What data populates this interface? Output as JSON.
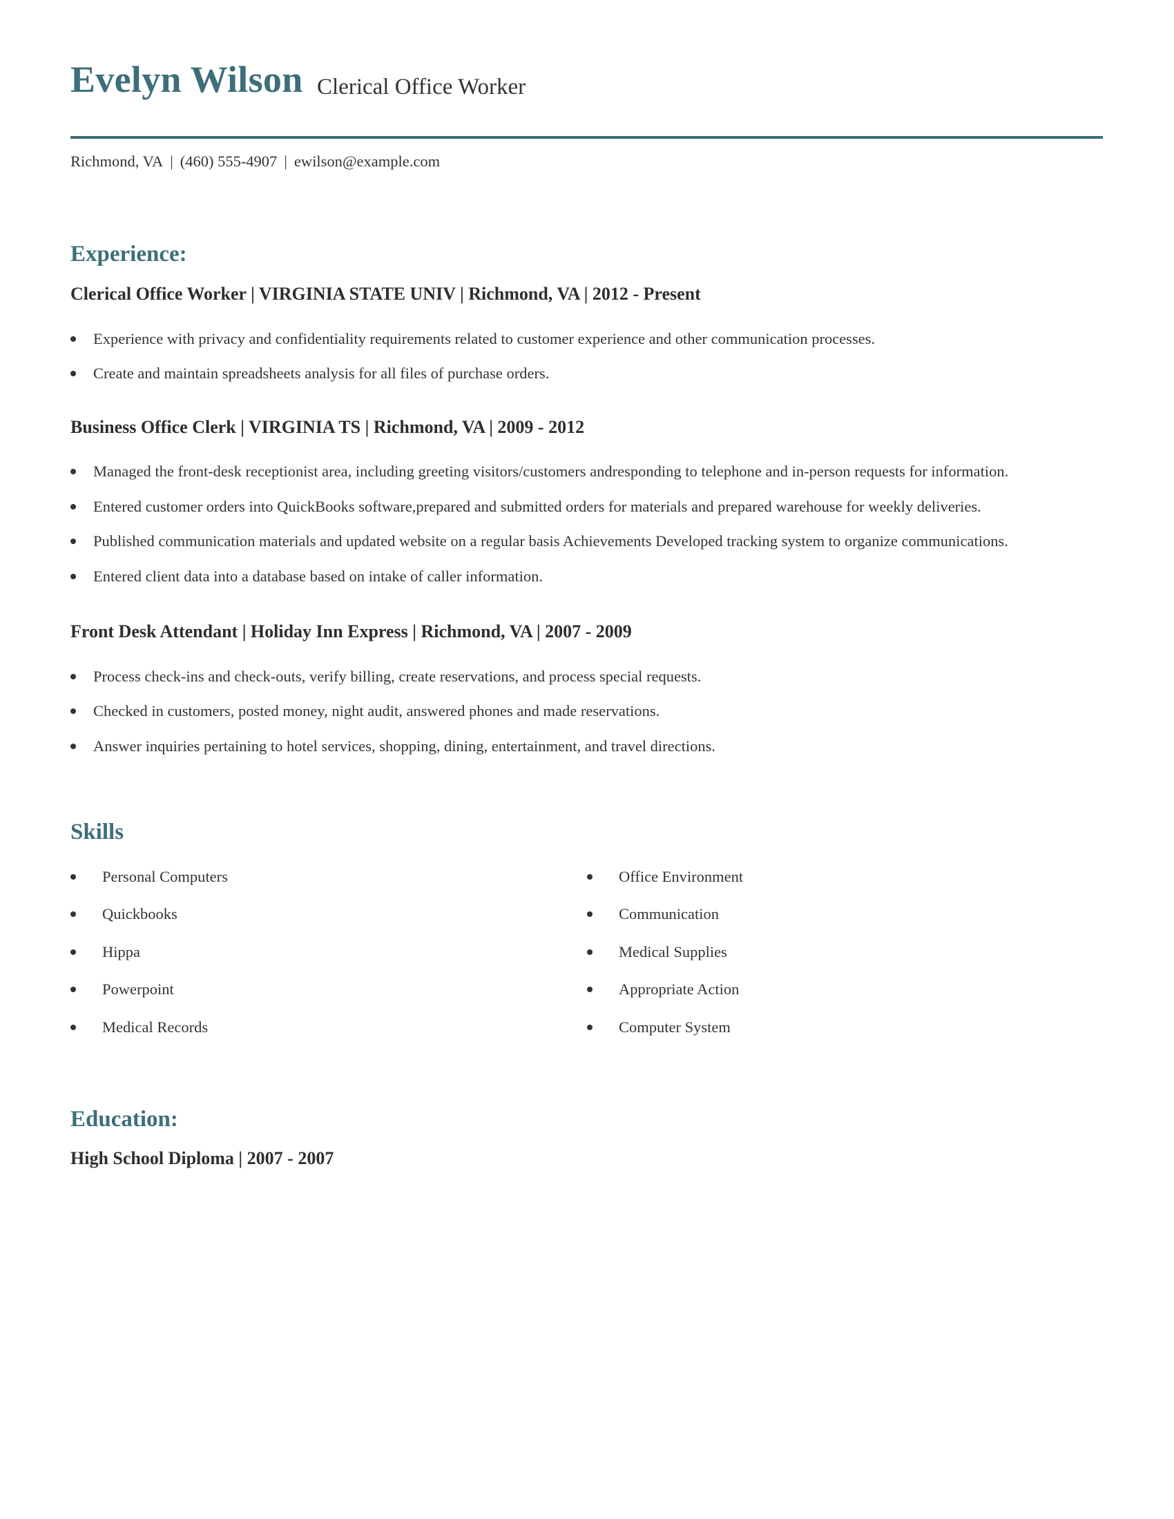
{
  "header": {
    "name": "Evelyn Wilson",
    "title": "Clerical Office Worker",
    "accent_color": "#3d6e7a"
  },
  "contact": {
    "location": "Richmond, VA",
    "separator": "|",
    "phone": "(460) 555-4907",
    "email": "ewilson@example.com"
  },
  "experience": {
    "heading": "Experience:",
    "jobs": [
      {
        "title_line": "Clerical Office Worker | VIRGINIA STATE UNIV | Richmond, VA |  2012 - Present",
        "bullets": [
          "Experience with privacy and confidentiality requirements related to customer experience and other communication processes.",
          "Create and maintain spreadsheets analysis for all files of purchase orders."
        ]
      },
      {
        "title_line": "Business Office Clerk | VIRGINIA TS | Richmond, VA |  2009 - 2012",
        "bullets": [
          "Managed the front-desk receptionist area, including greeting visitors/customers andresponding to telephone and in-person requests for information.",
          "Entered customer orders into QuickBooks software,prepared and submitted orders for materials and prepared warehouse for weekly deliveries.",
          "Published communication materials and updated website on a regular basis Achievements Developed tracking system to organize communications.",
          "Entered client data into a database based on intake of caller information."
        ]
      },
      {
        "title_line": "Front Desk Attendant | Holiday Inn Express | Richmond, VA |  2007 - 2009",
        "bullets": [
          "Process check-ins and check-outs, verify billing, create reservations, and process special requests.",
          "Checked in customers, posted money, night audit, answered phones and made reservations.",
          "Answer inquiries pertaining to hotel services, shopping, dining, entertainment, and travel directions."
        ]
      }
    ]
  },
  "skills": {
    "heading": "Skills",
    "left": [
      "Personal Computers",
      "Quickbooks",
      "Hippa",
      "Powerpoint",
      "Medical Records"
    ],
    "right": [
      "Office Environment",
      "Communication",
      "Medical Supplies",
      "Appropriate Action",
      "Computer System"
    ]
  },
  "education": {
    "heading": "Education:",
    "entry": "High School Diploma |  2007 - 2007"
  }
}
